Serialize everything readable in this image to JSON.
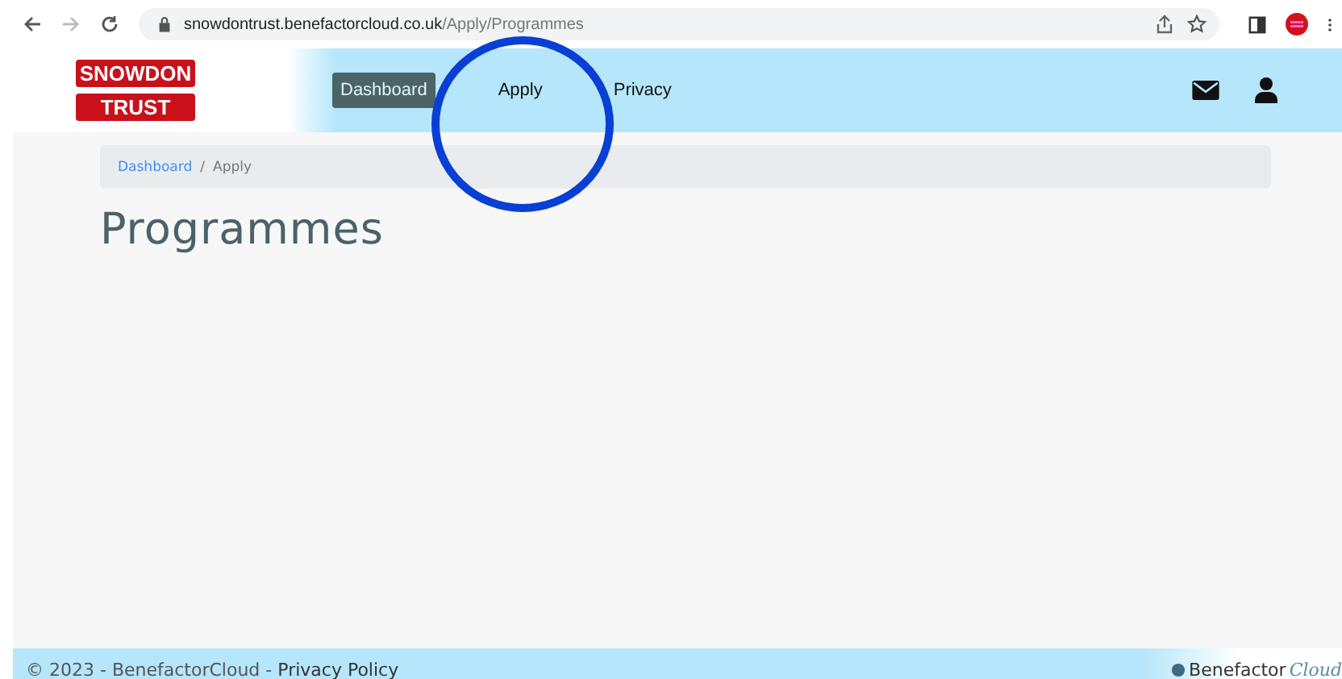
{
  "browser": {
    "url_host": "snowdontrust.benefactorcloud.co.uk",
    "url_path": "/Apply/Programmes"
  },
  "logo": {
    "line1": "SNOWDON",
    "line2": "TRUST"
  },
  "nav": [
    {
      "label": "Dashboard",
      "selected": true
    },
    {
      "label": "Apply",
      "selected": false
    },
    {
      "label": "Privacy",
      "selected": false
    }
  ],
  "breadcrumb": [
    {
      "label": "Dashboard",
      "kind": "link"
    },
    {
      "label": "/",
      "kind": "separator"
    },
    {
      "label": "Apply",
      "kind": "current"
    }
  ],
  "title": "Programmes",
  "footer": {
    "text": "© 2023 - BenefactorCloud - ",
    "link": "Privacy Policy",
    "brand": "Benefactor",
    "brand_italic": "Cloud"
  },
  "annotation": {
    "kind": "circle"
  }
}
